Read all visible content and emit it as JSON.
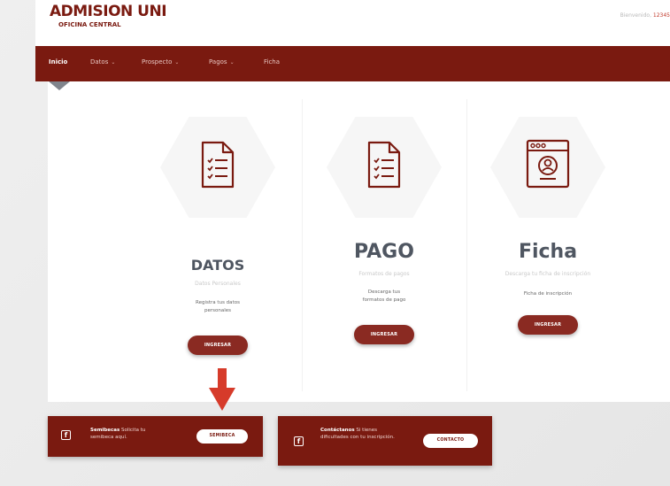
{
  "header": {
    "logo_title": "ADMISION UNI",
    "logo_subtitle": "OFICINA CENTRAL",
    "welcome_text": "Bienvenido,",
    "welcome_code": "12345"
  },
  "nav": {
    "items": [
      {
        "label": "Inicio",
        "has_dropdown": false,
        "active": true
      },
      {
        "label": "Datos",
        "has_dropdown": true
      },
      {
        "label": "Prospecto",
        "has_dropdown": true
      },
      {
        "label": "Pagos",
        "has_dropdown": true
      },
      {
        "label": "Ficha",
        "has_dropdown": false
      }
    ],
    "caret": "⌄"
  },
  "cards": [
    {
      "icon": "checklist-document-icon",
      "title": "DATOS",
      "subtitle": "Datos Personales",
      "description": "Registra tus datos personales",
      "button_label": "INGRESAR"
    },
    {
      "icon": "checklist-document-icon",
      "title": "PAGO",
      "subtitle": "Formatos de pagos",
      "description": "Descarga tus formatos de pago",
      "button_label": "INGRESAR"
    },
    {
      "icon": "browser-user-icon",
      "title": "Ficha",
      "subtitle": "Descarga tu ficha de inscripción",
      "description": "Ficha de inscripción",
      "button_label": "INGRESAR"
    }
  ],
  "bottom": {
    "semibeca": {
      "icon": "facebook-icon",
      "bold": "Semibecas",
      "text": "Solicita tu semibeca aquí.",
      "button_label": "SEMIBECA"
    },
    "contacto": {
      "icon": "facebook-icon",
      "bold": "Contáctanos",
      "text": "Si tienes dificultades con tu inscripción.",
      "button_label": "CONTACTO"
    }
  },
  "colors": {
    "brand": "#7a1a10",
    "arrow": "#d63b2a",
    "title_text": "#4f5661"
  }
}
